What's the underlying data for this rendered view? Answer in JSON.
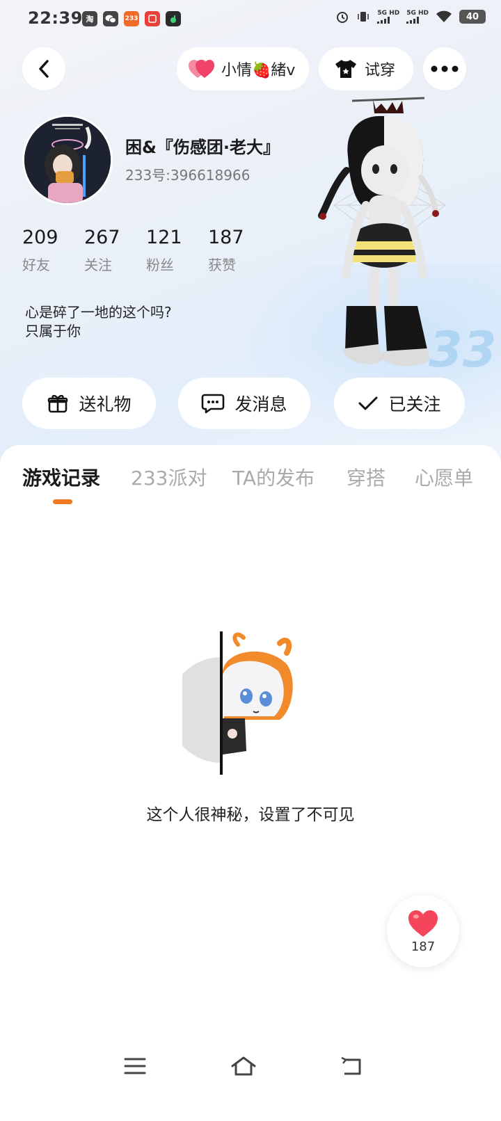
{
  "status_bar": {
    "time": "22:39",
    "app_icons": [
      {
        "name": "taobao-icon",
        "label": "淘",
        "color": "#444444"
      },
      {
        "name": "wechat-icon",
        "label": "",
        "color": "#444444"
      },
      {
        "name": "app-233-icon",
        "label": "233",
        "color": "#f06a2a"
      },
      {
        "name": "app-red-icon",
        "label": "",
        "color": "#e8403a"
      },
      {
        "name": "app-green-icon",
        "label": "",
        "color": "#2b2b2b"
      }
    ],
    "network_1": "5G HD",
    "network_2": "5G HD",
    "battery": "40"
  },
  "top_nav": {
    "mood_label": "小情🍓緒v",
    "tryon_label": "试穿"
  },
  "profile": {
    "username": "困&『伤感团·老大』",
    "uid": "233号:396618966",
    "stats": [
      {
        "num": "209",
        "label": "好友"
      },
      {
        "num": "267",
        "label": "关注"
      },
      {
        "num": "121",
        "label": "粉丝"
      },
      {
        "num": "187",
        "label": "获赞"
      }
    ],
    "bio": "心是碎了一地的这个吗?\n只属于你"
  },
  "deco_text": "33",
  "actions": {
    "gift": "送礼物",
    "message": "发消息",
    "follow": "已关注"
  },
  "tabs": [
    "游戏记录",
    "233派对",
    "TA的发布",
    "穿搭",
    "心愿单"
  ],
  "active_tab": 0,
  "empty_state": {
    "text": "这个人很神秘，设置了不可见"
  },
  "like": {
    "count": "187"
  },
  "colors": {
    "accent": "#f07a22",
    "heart": "#f5455a"
  }
}
